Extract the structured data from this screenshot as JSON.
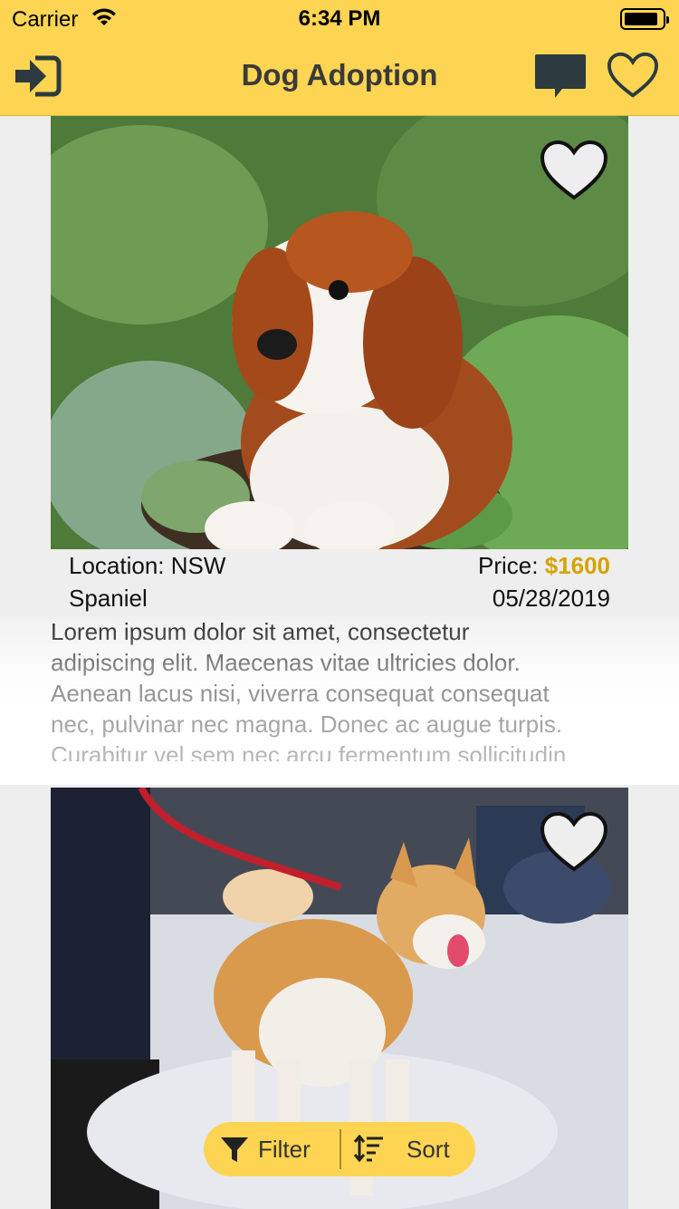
{
  "status_bar": {
    "carrier": "Carrier",
    "time": "6:34 PM",
    "icons": [
      "wifi-icon",
      "battery-icon"
    ]
  },
  "navbar": {
    "title": "Dog Adoption",
    "icons": [
      "login-icon",
      "chat-icon",
      "heart-outline-icon"
    ]
  },
  "listings": [
    {
      "location": "Location: NSW",
      "price_label": "Price:",
      "price_value": "$1600",
      "breed": "Spaniel",
      "date": "05/28/2019",
      "description": "Lorem ipsum dolor sit amet, consectetur\nadipiscing elit. Maecenas vitae ultricies dolor.\nAenean lacus nisi, viverra consequat consequat\nnec, pulvinar nec magna. Donec ac augue turpis.\nCurabitur vel sem nec arcu fermentum sollicitudin",
      "favorite_icon": "heart-icon"
    },
    {
      "favorite_icon": "heart-icon"
    }
  ],
  "bottom_pill": {
    "filter_label": "Filter",
    "sort_label": "Sort",
    "icons": [
      "filter-icon",
      "sort-icon"
    ]
  },
  "colors": {
    "accent": "#fdd552",
    "price": "#d6a300"
  }
}
